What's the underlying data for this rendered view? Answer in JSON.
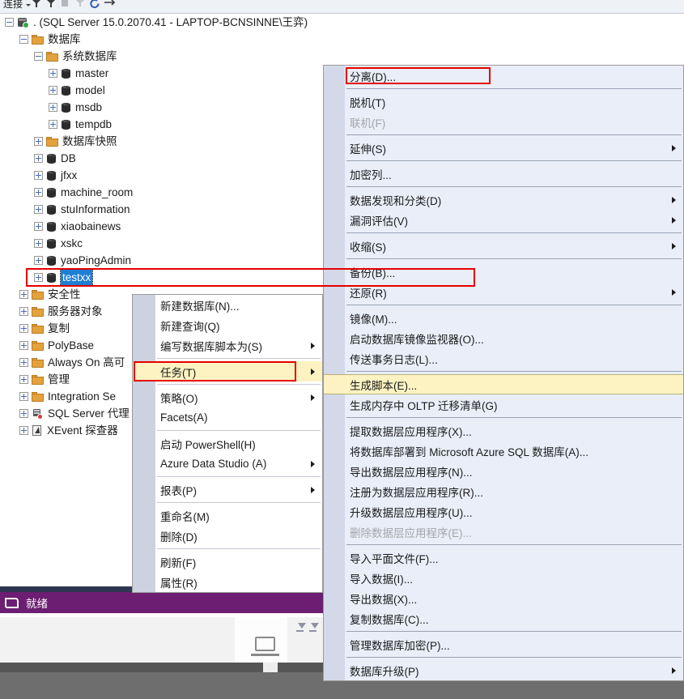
{
  "toolbar": {
    "connect_label": "连接",
    "icons": [
      "connect-caret-icon",
      "filter-icon",
      "filter-2-icon",
      "stop-icon",
      "clear-filter-icon",
      "refresh-icon",
      "sync-icon"
    ]
  },
  "tree": {
    "nodes": [
      {
        "label": ". (SQL Server 15.0.2070.41 - LAPTOP-BCNSINNE\\王弈)",
        "depth": 0,
        "icon": "server-icon",
        "expander": "minus"
      },
      {
        "label": "数据库",
        "depth": 1,
        "icon": "folder-icon",
        "expander": "minus"
      },
      {
        "label": "系统数据库",
        "depth": 2,
        "icon": "folder-icon",
        "expander": "minus"
      },
      {
        "label": "master",
        "depth": 3,
        "icon": "database-icon",
        "expander": "plus"
      },
      {
        "label": "model",
        "depth": 3,
        "icon": "database-icon",
        "expander": "plus"
      },
      {
        "label": "msdb",
        "depth": 3,
        "icon": "database-icon",
        "expander": "plus"
      },
      {
        "label": "tempdb",
        "depth": 3,
        "icon": "database-icon",
        "expander": "plus"
      },
      {
        "label": "数据库快照",
        "depth": 2,
        "icon": "folder-icon",
        "expander": "plus"
      },
      {
        "label": "DB",
        "depth": 2,
        "icon": "database-icon",
        "expander": "plus"
      },
      {
        "label": "jfxx",
        "depth": 2,
        "icon": "database-icon",
        "expander": "plus"
      },
      {
        "label": "machine_room",
        "depth": 2,
        "icon": "database-icon",
        "expander": "plus"
      },
      {
        "label": "stuInformation",
        "depth": 2,
        "icon": "database-icon",
        "expander": "plus"
      },
      {
        "label": "xiaobainews",
        "depth": 2,
        "icon": "database-icon",
        "expander": "plus"
      },
      {
        "label": "xskc",
        "depth": 2,
        "icon": "database-icon",
        "expander": "plus"
      },
      {
        "label": "yaoPingAdmin",
        "depth": 2,
        "icon": "database-icon",
        "expander": "plus"
      },
      {
        "label": "testxx",
        "depth": 2,
        "icon": "database-icon",
        "expander": "plus",
        "selected": true
      },
      {
        "label": "安全性",
        "depth": 1,
        "icon": "folder-icon",
        "expander": "plus"
      },
      {
        "label": "服务器对象",
        "depth": 1,
        "icon": "folder-icon",
        "expander": "plus"
      },
      {
        "label": "复制",
        "depth": 1,
        "icon": "folder-icon",
        "expander": "plus"
      },
      {
        "label": "PolyBase",
        "depth": 1,
        "icon": "folder-icon",
        "expander": "plus"
      },
      {
        "label": "Always On 高可",
        "depth": 1,
        "icon": "folder-icon",
        "expander": "plus"
      },
      {
        "label": "管理",
        "depth": 1,
        "icon": "folder-icon",
        "expander": "plus"
      },
      {
        "label": "Integration Se",
        "depth": 1,
        "icon": "folder-icon",
        "expander": "plus"
      },
      {
        "label": "SQL Server 代理",
        "depth": 1,
        "icon": "agent-icon",
        "expander": "plus"
      },
      {
        "label": "XEvent 探查器",
        "depth": 1,
        "icon": "xevent-icon",
        "expander": "plus"
      }
    ]
  },
  "context_menu": {
    "items": [
      {
        "label": "新建数据库(N)...",
        "submenu": false
      },
      {
        "label": "新建查询(Q)",
        "submenu": false
      },
      {
        "label": "编写数据库脚本为(S)",
        "submenu": true
      },
      {
        "separator": true
      },
      {
        "label": "任务(T)",
        "submenu": true,
        "highlighted": true
      },
      {
        "separator": true
      },
      {
        "label": "策略(O)",
        "submenu": true
      },
      {
        "label": "Facets(A)",
        "submenu": false
      },
      {
        "separator": true
      },
      {
        "label": "启动 PowerShell(H)",
        "submenu": false
      },
      {
        "label": "Azure Data Studio (A)",
        "submenu": true
      },
      {
        "separator": true
      },
      {
        "label": "报表(P)",
        "submenu": true
      },
      {
        "separator": true
      },
      {
        "label": "重命名(M)",
        "submenu": false
      },
      {
        "label": "删除(D)",
        "submenu": false
      },
      {
        "separator": true
      },
      {
        "label": "刷新(F)",
        "submenu": false
      },
      {
        "label": "属性(R)",
        "submenu": false
      }
    ]
  },
  "tasks_submenu": {
    "items": [
      {
        "label": "分离(D)...",
        "submenu": false,
        "boxed": true
      },
      {
        "separator": true
      },
      {
        "label": "脱机(T)",
        "submenu": false
      },
      {
        "label": "联机(F)",
        "submenu": false,
        "disabled": true
      },
      {
        "separator": true
      },
      {
        "label": "延伸(S)",
        "submenu": true
      },
      {
        "separator": true
      },
      {
        "label": "加密列...",
        "submenu": false
      },
      {
        "separator": true
      },
      {
        "label": "数据发现和分类(D)",
        "submenu": true
      },
      {
        "label": "漏洞评估(V)",
        "submenu": true
      },
      {
        "separator": true
      },
      {
        "label": "收缩(S)",
        "submenu": true
      },
      {
        "separator": true
      },
      {
        "label": "备份(B)...",
        "submenu": false
      },
      {
        "label": "还原(R)",
        "submenu": true
      },
      {
        "separator": true
      },
      {
        "label": "镜像(M)...",
        "submenu": false
      },
      {
        "label": "启动数据库镜像监视器(O)...",
        "submenu": false
      },
      {
        "label": "传送事务日志(L)...",
        "submenu": false
      },
      {
        "separator": true
      },
      {
        "label": "生成脚本(E)...",
        "submenu": false,
        "highlighted": true
      },
      {
        "label": "生成内存中 OLTP 迁移清单(G)",
        "submenu": false
      },
      {
        "separator": true
      },
      {
        "label": "提取数据层应用程序(X)...",
        "submenu": false
      },
      {
        "label": "将数据库部署到 Microsoft Azure SQL 数据库(A)...",
        "submenu": false
      },
      {
        "label": "导出数据层应用程序(N)...",
        "submenu": false
      },
      {
        "label": "注册为数据层应用程序(R)...",
        "submenu": false
      },
      {
        "label": "升级数据层应用程序(U)...",
        "submenu": false
      },
      {
        "label": "删除数据层应用程序(E)...",
        "submenu": false,
        "disabled": true
      },
      {
        "separator": true
      },
      {
        "label": "导入平面文件(F)...",
        "submenu": false
      },
      {
        "label": "导入数据(I)...",
        "submenu": false
      },
      {
        "label": "导出数据(X)...",
        "submenu": false
      },
      {
        "label": "复制数据库(C)...",
        "submenu": false
      },
      {
        "separator": true
      },
      {
        "label": "管理数据库加密(P)...",
        "submenu": false
      },
      {
        "separator": true
      },
      {
        "label": "数据库升级(P)",
        "submenu": true
      }
    ]
  },
  "status_bar": {
    "text": "就绪",
    "icon": "ready-icon"
  },
  "colors": {
    "selection_blue": "#1e7fd4",
    "highlight_yellow": "#fdf3c2",
    "annotation_red": "#e60000",
    "status_purple": "#6c1e72",
    "submenu_background": "#e9eef9",
    "folder_orange": "#e3a23c"
  }
}
